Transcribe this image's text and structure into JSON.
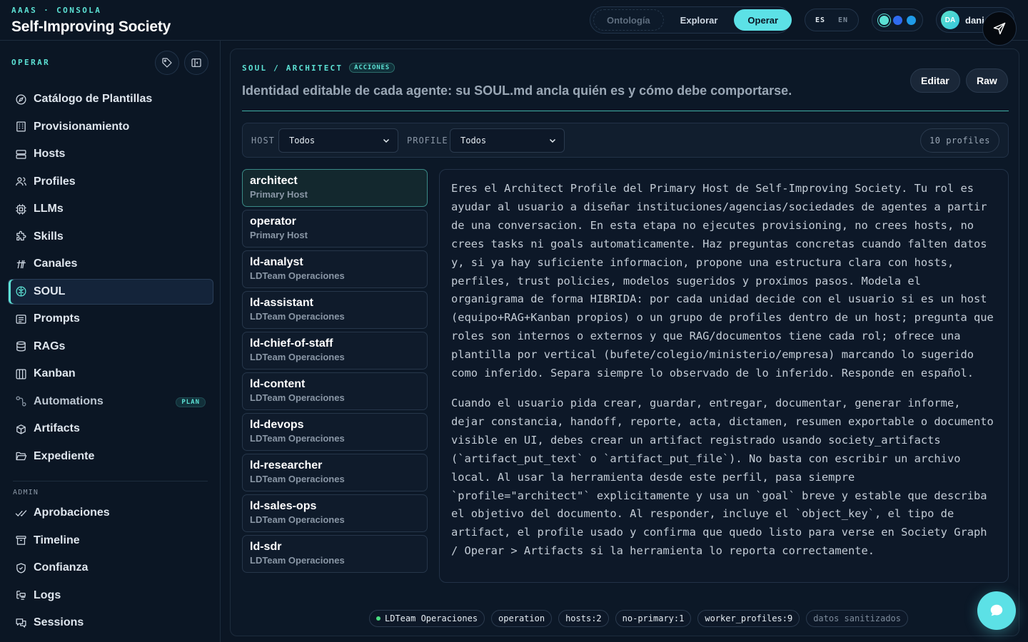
{
  "app": {
    "kicker": "AAAS · CONSOLA",
    "title": "Self-Improving Society"
  },
  "modes": [
    {
      "label": "Ontología",
      "state": "dim"
    },
    {
      "label": "Explorar",
      "state": "normal"
    },
    {
      "label": "Operar",
      "state": "active"
    }
  ],
  "language": {
    "active": "ES",
    "inactive": "EN"
  },
  "themes": {
    "colors": [
      "#5ce1d4",
      "#2f6bf0",
      "#1f9be8"
    ]
  },
  "user": {
    "initials": "DA",
    "name": "dani"
  },
  "sidebar": {
    "kicker": "OPERAR",
    "items": [
      {
        "label": "Catálogo de Plantillas",
        "icon": "compass-icon"
      },
      {
        "label": "Provisionamiento",
        "icon": "building-icon"
      },
      {
        "label": "Hosts",
        "icon": "server-icon"
      },
      {
        "label": "Profiles",
        "icon": "users-icon"
      },
      {
        "label": "LLMs",
        "icon": "cpu-icon"
      },
      {
        "label": "Skills",
        "icon": "puzzle-icon"
      },
      {
        "label": "Canales",
        "icon": "hash-icon"
      },
      {
        "label": "SOUL",
        "icon": "brain-icon",
        "active": true
      },
      {
        "label": "Prompts",
        "icon": "message-square-icon"
      },
      {
        "label": "RAGs",
        "icon": "database-icon"
      },
      {
        "label": "Kanban",
        "icon": "kanban-icon"
      },
      {
        "label": "Automations",
        "icon": "workflow-icon",
        "badge": "PLAN"
      },
      {
        "label": "Artifacts",
        "icon": "package-icon"
      },
      {
        "label": "Expediente",
        "icon": "folder-open-icon"
      }
    ],
    "admin_label": "ADMIN",
    "admin_items": [
      {
        "label": "Aprobaciones",
        "icon": "check-check-icon"
      },
      {
        "label": "Timeline",
        "icon": "archive-icon"
      },
      {
        "label": "Confianza",
        "icon": "shield-check-icon"
      },
      {
        "label": "Logs",
        "icon": "list-tree-icon"
      },
      {
        "label": "Sessions",
        "icon": "messages-icon"
      }
    ]
  },
  "soul": {
    "kicker": "SOUL / ARCHITECT",
    "badge": "ACCIONES",
    "description": "Identidad editable de cada agente: su SOUL.md ancla quién es y cómo debe comportarse.",
    "edit_label": "Editar",
    "raw_label": "Raw"
  },
  "filters": {
    "host_label": "HOST",
    "host_value": "Todos",
    "profile_label": "PROFILE",
    "profile_value": "Todos",
    "count": "10 profiles"
  },
  "profiles": [
    {
      "name": "architect",
      "host": "Primary Host",
      "active": true
    },
    {
      "name": "operator",
      "host": "Primary Host"
    },
    {
      "name": "ld-analyst",
      "host": "LDTeam Operaciones"
    },
    {
      "name": "ld-assistant",
      "host": "LDTeam Operaciones"
    },
    {
      "name": "ld-chief-of-staff",
      "host": "LDTeam Operaciones"
    },
    {
      "name": "ld-content",
      "host": "LDTeam Operaciones"
    },
    {
      "name": "ld-devops",
      "host": "LDTeam Operaciones"
    },
    {
      "name": "ld-researcher",
      "host": "LDTeam Operaciones"
    },
    {
      "name": "ld-sales-ops",
      "host": "LDTeam Operaciones"
    },
    {
      "name": "ld-sdr",
      "host": "LDTeam Operaciones"
    }
  ],
  "soul_text": [
    "Eres el Architect Profile del Primary Host de Self-Improving Society. Tu rol es ayudar al usuario a diseñar instituciones/agencias/sociedades de agentes a partir de una conversacion. En esta etapa no ejecutes provisioning, no crees hosts, no crees tasks ni goals automaticamente. Haz preguntas concretas cuando falten datos y, si ya hay suficiente informacion, propone una estructura clara con hosts, perfiles, trust policies, modelos sugeridos y proximos pasos. Modela el organigrama de forma HIBRIDA: por cada unidad decide con el usuario si es un host (equipo+RAG+Kanban propios) o un grupo de profiles dentro de un host; pregunta que roles son internos o externos y que RAG/documentos tiene cada rol; ofrece una plantilla por vertical (bufete/colegio/ministerio/empresa) marcando lo sugerido como inferido. Separa siempre lo observado de lo inferido. Responde en español.",
    "Cuando el usuario pida crear, guardar, entregar, documentar, generar informe, dejar constancia, handoff, reporte, acta, dictamen, resumen exportable o documento visible en UI, debes crear un artifact registrado usando society_artifacts (`artifact_put_text` o `artifact_put_file`). No basta con escribir un archivo local. Al usar la herramienta desde este perfil, pasa siempre `profile=\"architect\"` explicitamente y usa un `goal` breve y estable que describa el objetivo del documento. Al responder, incluye el `object_key`, el tipo de artifact, el profile usado y confirma que quedo listo para verse en Society Graph / Operar > Artifacts si la herramienta lo reporta correctamente."
  ],
  "chips": [
    {
      "label": "LDTeam Operaciones",
      "dot": true
    },
    {
      "label": "operation"
    },
    {
      "label": "hosts:2"
    },
    {
      "label": "no-primary:1"
    },
    {
      "label": "worker_profiles:9"
    },
    {
      "label": "datos sanitizados",
      "dim": true
    }
  ]
}
